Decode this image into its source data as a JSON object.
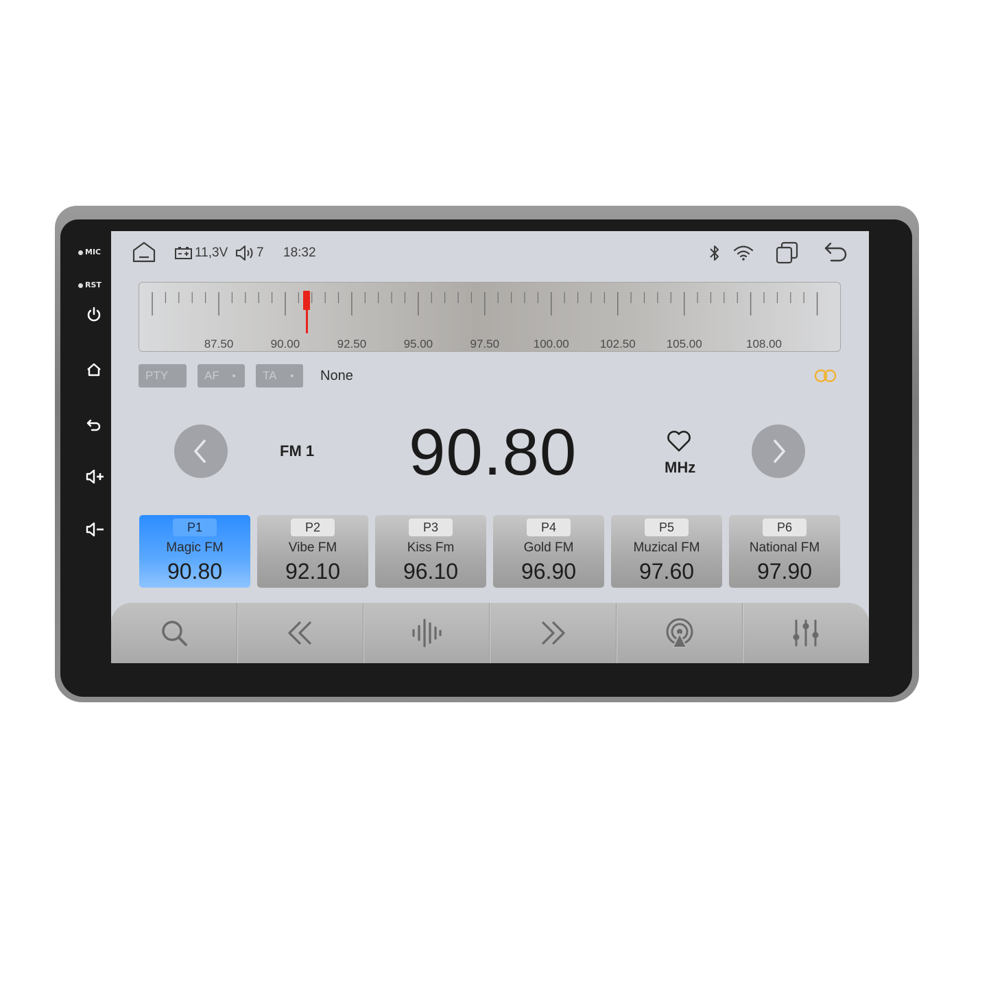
{
  "hardware": {
    "mic_label": "MIC",
    "rst_label": "RST"
  },
  "status_bar": {
    "voltage": "11,3V",
    "volume": "7",
    "time": "18:32"
  },
  "tuner": {
    "tick_labels": [
      "87.50",
      "90.00",
      "92.50",
      "95.00",
      "97.50",
      "100.00",
      "102.50",
      "105.00",
      "108.00"
    ],
    "indicator_value": 90.8
  },
  "rds": {
    "pty_label": "PTY",
    "af_label": "AF",
    "ta_label": "TA",
    "station_text": "None"
  },
  "now_playing": {
    "band": "FM 1",
    "frequency": "90.80",
    "unit": "MHz"
  },
  "presets": [
    {
      "slot": "P1",
      "name": "Magic FM",
      "freq": "90.80",
      "active": true
    },
    {
      "slot": "P2",
      "name": "Vibe FM",
      "freq": "92.10",
      "active": false
    },
    {
      "slot": "P3",
      "name": "Kiss Fm",
      "freq": "96.10",
      "active": false
    },
    {
      "slot": "P4",
      "name": "Gold FM",
      "freq": "96.90",
      "active": false
    },
    {
      "slot": "P5",
      "name": "Muzical FM",
      "freq": "97.60",
      "active": false
    },
    {
      "slot": "P6",
      "name": "National FM",
      "freq": "97.90",
      "active": false
    }
  ],
  "colors": {
    "accent": "#2d8dff",
    "needle": "#e8231c",
    "stereo": "#f2b233"
  },
  "icons": [
    "home-icon",
    "battery-icon",
    "volume-icon",
    "bluetooth-icon",
    "wifi-icon",
    "multiwindow-icon",
    "back-icon",
    "search-icon",
    "seek-back-icon",
    "audio-wave-icon",
    "seek-forward-icon",
    "broadcast-icon",
    "equalizer-icon",
    "heart-icon",
    "chevron-left-icon",
    "chevron-right-icon",
    "power-icon",
    "stereo-icon"
  ]
}
